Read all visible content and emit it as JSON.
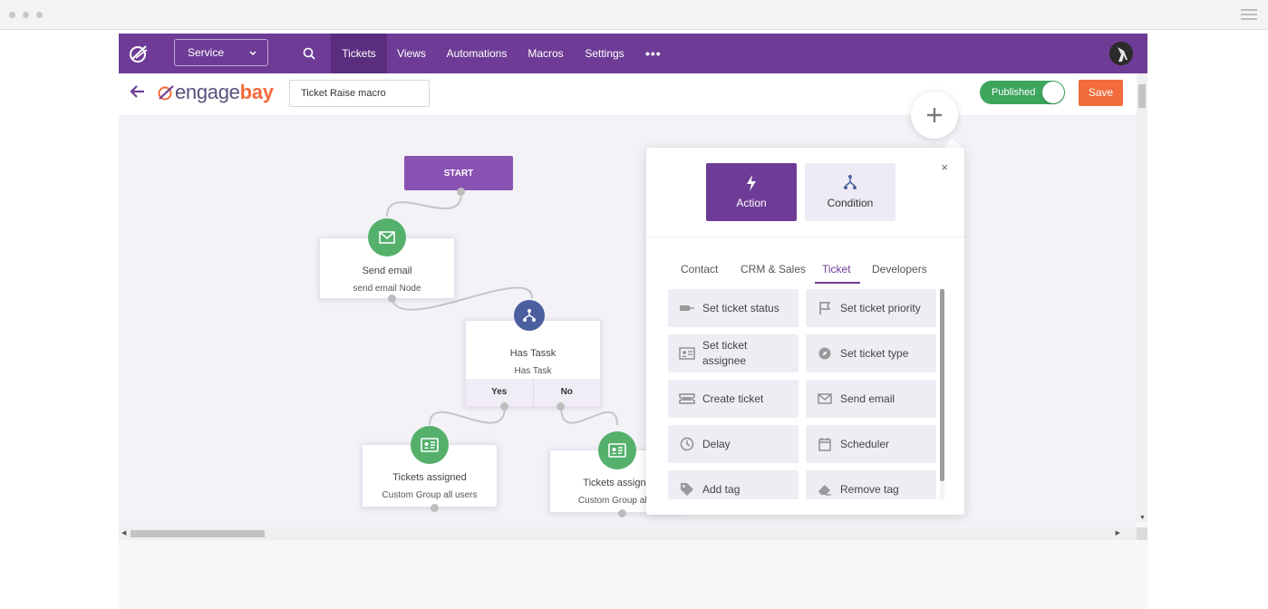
{
  "nav": {
    "service_select": "Service",
    "items": [
      "Tickets",
      "Views",
      "Automations",
      "Macros",
      "Settings"
    ],
    "more": "•••"
  },
  "header": {
    "brand_prefix": "engage",
    "brand_suffix": "bay",
    "macro_name": "Ticket Raise macro",
    "toggle_label": "Published",
    "save_label": "Save"
  },
  "flow": {
    "start_label": "START",
    "send_email": {
      "title": "Send email",
      "sub": "send email Node"
    },
    "has_task": {
      "title": "Has Tassk",
      "sub": "Has Task",
      "yes": "Yes",
      "no": "No"
    },
    "ticket_left": {
      "title": "Tickets assigned",
      "sub": "Custom Group all users"
    },
    "ticket_right": {
      "title": "Tickets assigne",
      "sub": "Custom Group all u"
    }
  },
  "panel": {
    "action_label": "Action",
    "condition_label": "Condition",
    "close": "×",
    "tabs": [
      "Contact",
      "CRM & Sales",
      "Ticket",
      "Developers"
    ],
    "active_tab": "Ticket",
    "tiles": [
      {
        "label": "Set ticket status",
        "icon": "ticket-status-icon"
      },
      {
        "label": "Set ticket priority",
        "icon": "flag-icon"
      },
      {
        "label": "Set ticket assignee",
        "icon": "id-card-icon"
      },
      {
        "label": "Set ticket type",
        "icon": "compass-icon"
      },
      {
        "label": "Create ticket",
        "icon": "ticket-icon"
      },
      {
        "label": "Send email",
        "icon": "envelope-icon"
      },
      {
        "label": "Delay",
        "icon": "clock-icon"
      },
      {
        "label": "Scheduler",
        "icon": "calendar-icon"
      },
      {
        "label": "Add tag",
        "icon": "tag-icon"
      },
      {
        "label": "Remove tag",
        "icon": "eraser-icon"
      }
    ]
  },
  "colors": {
    "brand_purple": "#6e3c96",
    "accent_orange": "#f26b3a",
    "published_green": "#3ea55d",
    "node_green": "#54b06b",
    "node_blue": "#4b5f9f"
  }
}
